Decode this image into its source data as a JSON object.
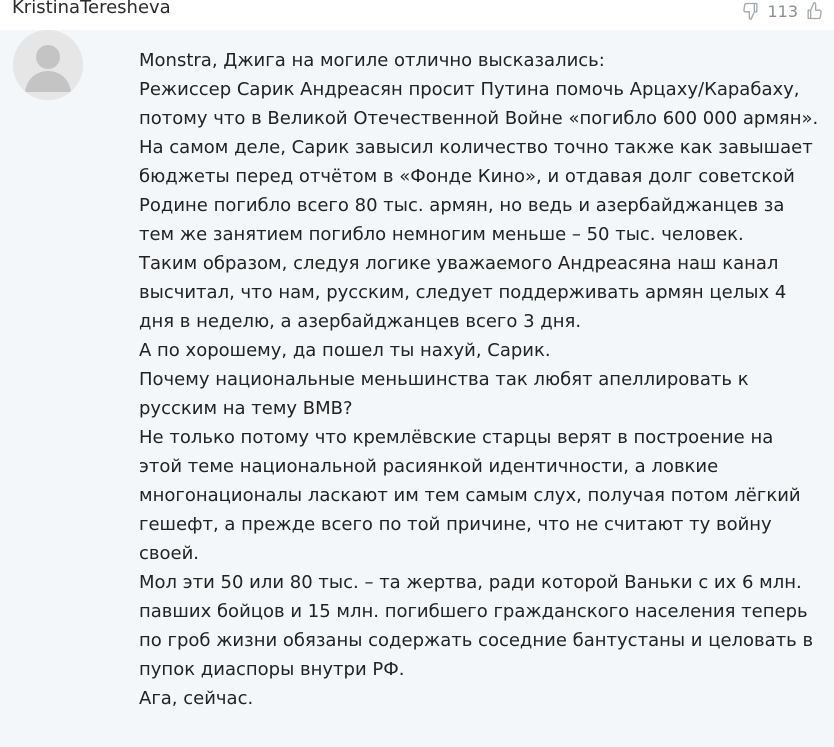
{
  "comment": {
    "author": "KristinaTeresheva",
    "vote": {
      "icon": "thumbs-down-icon",
      "count": "113"
    },
    "avatar": {
      "icon": "user-avatar-icon"
    },
    "paragraphs": [
      "Monstra, Джига на могиле отлично высказались:",
      "Режиссер Сарик Андреасян просит Путина помочь Арцаху/Карабаху, потому что в Великой Отечественной Войне «погибло 600 000 армян».",
      "На самом деле, Сарик завысил количество точно также как завышает бюджеты перед отчётом в «Фонде Кино», и отдавая долг советской Родине погибло всего 80 тыс. армян, но ведь и азербайджанцев за тем же занятием погибло немногим меньше – 50 тыс. человек.",
      "Таким образом, следуя логике уважаемого Андреасяна наш канал высчитал, что нам, русским, следует поддерживать армян целых 4 дня в неделю, а азербайджанцев всего 3 дня.",
      "А по хорошему, да пошел ты нахуй, Сарик.",
      "Почему национальные меньшинства так любят апеллировать к русским на тему ВМВ?",
      "Не только потому что кремлёвские старцы верят в построение на этой теме национальной расиянкой идентичности, а ловкие многонационалы ласкают им тем самым слух, получая потом лёгкий гешефт, а прежде всего по той причине, что не считают ту войну своей.",
      "Мол эти 50 или 80 тыс. – та жертва, ради которой Ваньки с их 6 млн. павших бойцов и 15 млн. погибшего гражданского населения теперь по гроб жизни обязаны содержать соседние бантустаны и целовать в пупок диаспоры внутри РФ.",
      "Ага, сейчас."
    ]
  },
  "colors": {
    "background": "#f4f7f9",
    "avatar_bg": "#e6e6e6",
    "avatar_fg": "#c4c4c4"
  }
}
